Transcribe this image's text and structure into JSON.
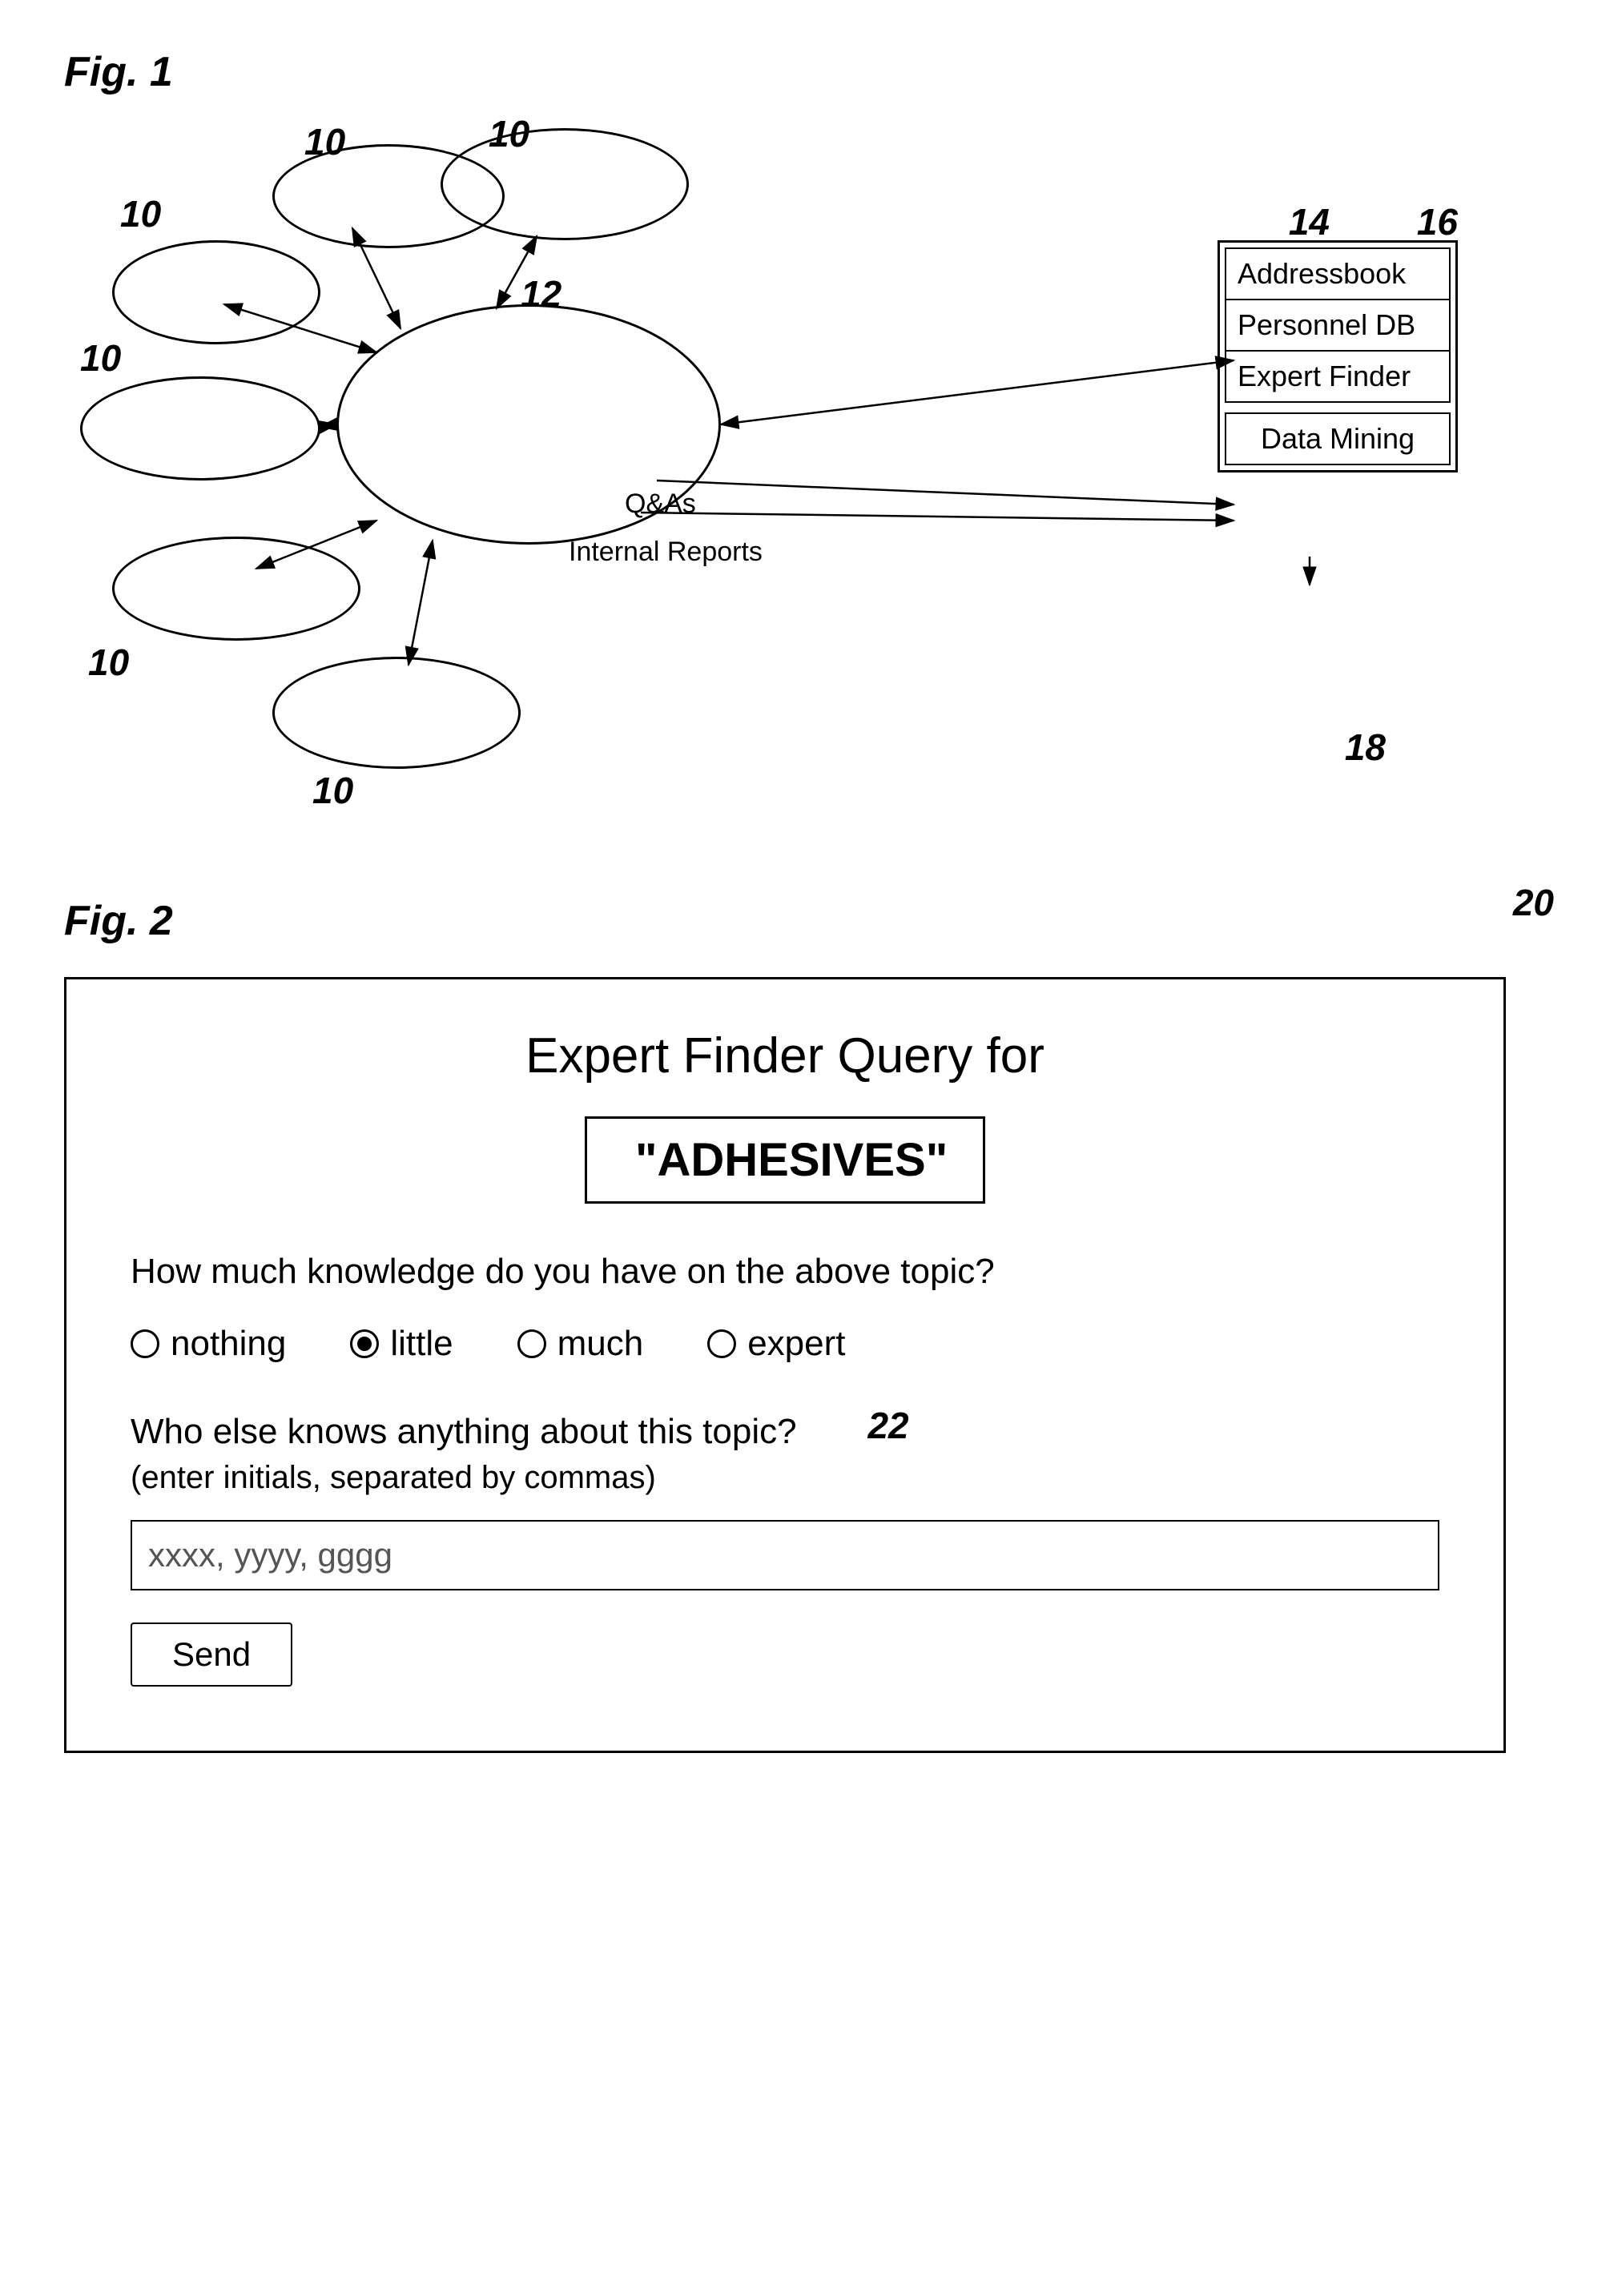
{
  "fig1": {
    "label": "Fig. 1",
    "refs": {
      "top_left_10a": "10",
      "top_center_10": "10",
      "left_mid_10": "10",
      "bottom_left_10": "10",
      "bottom_center_10": "10",
      "center_12": "12",
      "ref_14": "14",
      "ref_16": "16",
      "ref_18": "18"
    },
    "db_box": {
      "rows": [
        "Addressbook",
        "Personnel DB",
        "Expert Finder"
      ],
      "mining": "Data Mining"
    },
    "labels": {
      "qas": "Q&As",
      "internal_reports": "Internal Reports"
    }
  },
  "fig2": {
    "label": "Fig. 2",
    "ref_20": "20",
    "ref_22": "22",
    "title": "Expert Finder Query for",
    "topic": "\"ADHESIVES\"",
    "question1": "How much knowledge do you have on the above topic?",
    "radio_options": [
      {
        "id": "nothing",
        "label": "nothing",
        "selected": false
      },
      {
        "id": "little",
        "label": "little",
        "selected": true
      },
      {
        "id": "much",
        "label": "much",
        "selected": false
      },
      {
        "id": "expert",
        "label": "expert",
        "selected": false
      }
    ],
    "question2_line1": "Who else knows anything about this topic?",
    "question2_line2": "(enter initials, separated by commas)",
    "initials_value": "xxxx, yyyy, gggg",
    "send_label": "Send"
  }
}
